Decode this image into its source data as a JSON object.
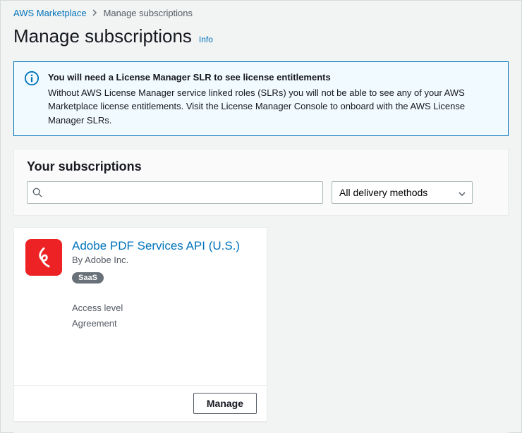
{
  "breadcrumb": {
    "root": "AWS Marketplace",
    "current": "Manage subscriptions"
  },
  "page": {
    "title": "Manage subscriptions",
    "info_label": "Info"
  },
  "alert": {
    "title": "You will need a License Manager SLR to see license entitlements",
    "body": "Without AWS License Manager service linked roles (SLRs) you will not be able to see any of your AWS Marketplace license entitlements. Visit the License Manager Console to onboard with the AWS License Manager SLRs."
  },
  "subscriptions": {
    "heading": "Your subscriptions",
    "search_placeholder": "",
    "filter_selected": "All delivery methods",
    "filter_options": [
      "All delivery methods"
    ]
  },
  "card": {
    "title": "Adobe PDF Services API (U.S.)",
    "vendor_prefix": "By",
    "vendor": "Adobe Inc.",
    "badge": "SaaS",
    "access_label": "Access level",
    "access_value": "Agreement",
    "manage_label": "Manage"
  }
}
